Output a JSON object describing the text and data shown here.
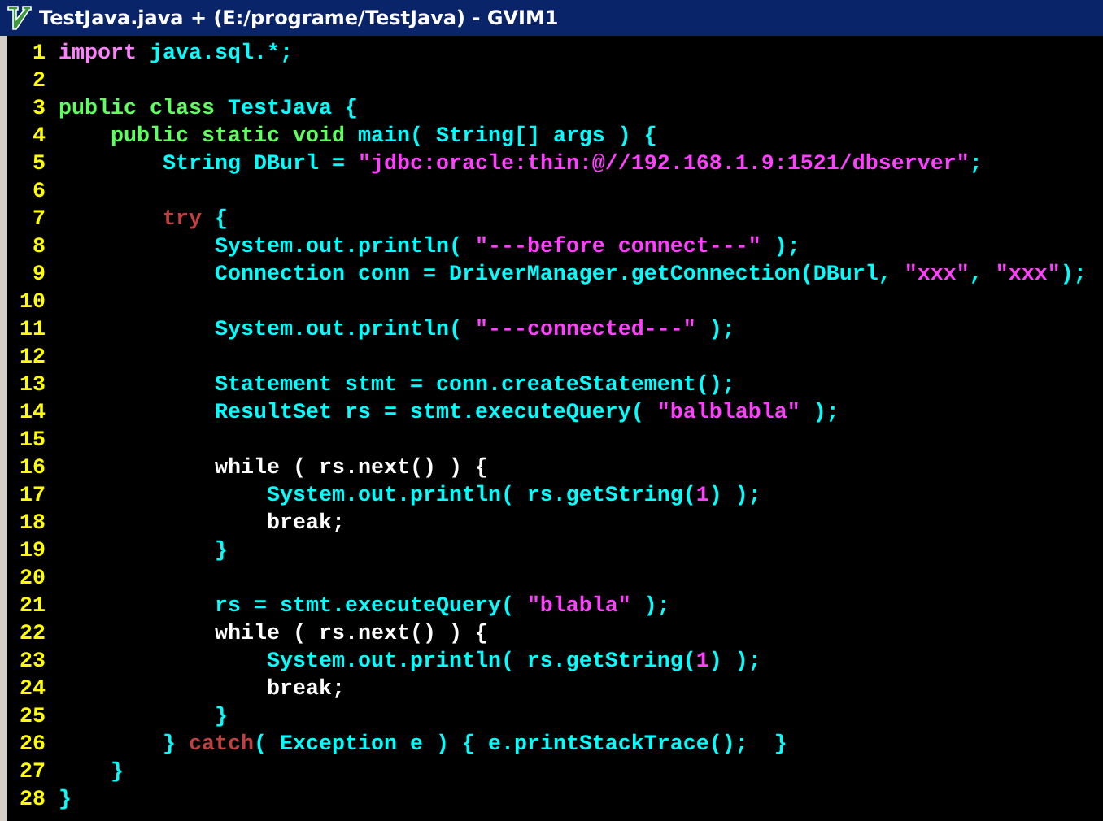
{
  "window": {
    "title": "TestJava.java + (E:/programe/TestJava) - GVIM1"
  },
  "lines": [
    {
      "number": "1",
      "tokens": [
        {
          "kind": "include",
          "text": "import"
        },
        {
          "kind": "ident",
          "text": " java.sql.*;"
        }
      ]
    },
    {
      "number": "2"
    },
    {
      "number": "3",
      "tokens": [
        {
          "kind": "type",
          "text": "public class"
        },
        {
          "kind": "ident",
          "text": " TestJava {"
        }
      ]
    },
    {
      "number": "4",
      "tokens": [
        {
          "kind": "type",
          "text": "    public static void"
        },
        {
          "kind": "ident",
          "text": " main( String[] args ) {"
        }
      ]
    },
    {
      "number": "5",
      "tokens": [
        {
          "kind": "ident",
          "text": "        String DBurl = "
        },
        {
          "kind": "string",
          "text": "\"jdbc:oracle:thin:@//192.168.1.9:1521/dbserver\""
        },
        {
          "kind": "ident",
          "text": ";"
        }
      ]
    },
    {
      "number": "6"
    },
    {
      "number": "7",
      "tokens": [
        {
          "kind": "exception",
          "text": "        try"
        },
        {
          "kind": "ident",
          "text": " {"
        }
      ]
    },
    {
      "number": "8",
      "tokens": [
        {
          "kind": "ident",
          "text": "            System.out.println( "
        },
        {
          "kind": "string",
          "text": "\"---before connect---\""
        },
        {
          "kind": "ident",
          "text": " );"
        }
      ]
    },
    {
      "number": "9",
      "tokens": [
        {
          "kind": "ident",
          "text": "            Connection conn = DriverManager.getConnection(DBurl, "
        },
        {
          "kind": "string",
          "text": "\"xxx\""
        },
        {
          "kind": "ident",
          "text": ", "
        },
        {
          "kind": "string",
          "text": "\"xxx\""
        },
        {
          "kind": "ident",
          "text": ");"
        }
      ]
    },
    {
      "number": "10"
    },
    {
      "number": "11",
      "tokens": [
        {
          "kind": "ident",
          "text": "            System.out.println( "
        },
        {
          "kind": "string",
          "text": "\"---connected---\""
        },
        {
          "kind": "ident",
          "text": " );"
        }
      ]
    },
    {
      "number": "12"
    },
    {
      "number": "13",
      "tokens": [
        {
          "kind": "ident",
          "text": "            Statement stmt = conn.createStatement();"
        }
      ]
    },
    {
      "number": "14",
      "tokens": [
        {
          "kind": "ident",
          "text": "            ResultSet rs = stmt.executeQuery( "
        },
        {
          "kind": "string",
          "text": "\"balblabla\""
        },
        {
          "kind": "ident",
          "text": " );"
        }
      ]
    },
    {
      "number": "15"
    },
    {
      "number": "16",
      "tokens": [
        {
          "kind": "statement",
          "text": "            while ( rs.next() ) {"
        }
      ]
    },
    {
      "number": "17",
      "tokens": [
        {
          "kind": "ident",
          "text": "                System.out.println( rs.getString("
        },
        {
          "kind": "number",
          "text": "1"
        },
        {
          "kind": "ident",
          "text": ") );"
        }
      ]
    },
    {
      "number": "18",
      "tokens": [
        {
          "kind": "statement",
          "text": "                break;"
        }
      ]
    },
    {
      "number": "19",
      "tokens": [
        {
          "kind": "ident",
          "text": "            }"
        }
      ]
    },
    {
      "number": "20"
    },
    {
      "number": "21",
      "tokens": [
        {
          "kind": "ident",
          "text": "            rs = stmt.executeQuery( "
        },
        {
          "kind": "string",
          "text": "\"blabla\""
        },
        {
          "kind": "ident",
          "text": " );"
        }
      ]
    },
    {
      "number": "22",
      "tokens": [
        {
          "kind": "statement",
          "text": "            while ( rs.next() ) {"
        }
      ]
    },
    {
      "number": "23",
      "tokens": [
        {
          "kind": "ident",
          "text": "                System.out.println( rs.getString("
        },
        {
          "kind": "number",
          "text": "1"
        },
        {
          "kind": "ident",
          "text": ") );"
        }
      ]
    },
    {
      "number": "24",
      "tokens": [
        {
          "kind": "statement",
          "text": "                break;"
        }
      ]
    },
    {
      "number": "25",
      "tokens": [
        {
          "kind": "ident",
          "text": "            }"
        }
      ]
    },
    {
      "number": "26",
      "tokens": [
        {
          "kind": "ident",
          "text": "        } "
        },
        {
          "kind": "exception",
          "text": "catch"
        },
        {
          "kind": "ident",
          "text": "( Exception e ) { e.printStackTrace();  }"
        }
      ]
    },
    {
      "number": "27",
      "tokens": [
        {
          "kind": "ident",
          "text": "    }"
        }
      ]
    },
    {
      "number": "28",
      "tokens": [
        {
          "kind": "ident",
          "text": "}"
        }
      ]
    }
  ]
}
